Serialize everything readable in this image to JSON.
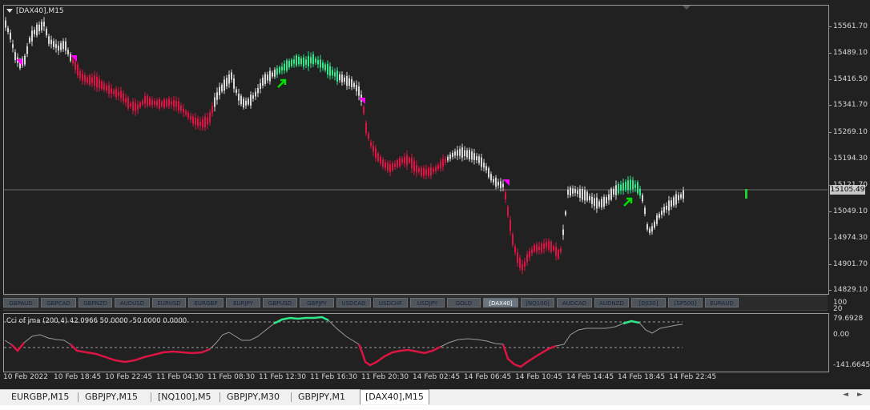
{
  "chart": {
    "title": "[DAX40],M15",
    "current_price": "15105.49",
    "price_labels": [
      "15561.70",
      "15489.10",
      "15416.50",
      "15341.70",
      "15269.10",
      "15194.30",
      "15121.70",
      "15049.10",
      "14974.30",
      "14901.70",
      "14829.10"
    ],
    "indicator_title": "Cci of jma (200,4) 42.0966 50.0000 -50.0000 0.0000",
    "indicator_top_labels": [
      "100",
      "20"
    ],
    "indicator_labels": [
      "79.6928",
      "0.00",
      "-141.6645"
    ],
    "time_labels": [
      "10 Feb 2022",
      "10 Feb 18:45",
      "10 Feb 22:45",
      "11 Feb 04:30",
      "11 Feb 08:30",
      "11 Feb 12:30",
      "11 Feb 16:30",
      "11 Feb 20:30",
      "14 Feb 02:45",
      "14 Feb 06:45",
      "14 Feb 10:45",
      "14 Feb 14:45",
      "14 Feb 18:45",
      "14 Feb 22:45"
    ],
    "colors": {
      "bear": "#dc1443",
      "bull": "#2ee88a",
      "neutral": "#d8d8d8",
      "signal_sell": "#ff00ff",
      "signal_buy": "#00e000"
    }
  },
  "symbols": [
    "GBPAUD",
    "GBPCAD",
    "GBPNZD",
    "AUDUSD",
    "EURUSD",
    "EURGBP",
    "EURJPY",
    "GBPUSD",
    "GBPJPY",
    "USDCAD",
    "USDCHF",
    "USDJPY",
    "GOLD",
    "[DAX40]",
    "[NQ100]",
    "AUDCAD",
    "AUDNZD",
    "[DJI30]",
    "[SP500]",
    "EURAUD"
  ],
  "active_symbol": "[DAX40]",
  "tabs": [
    "EURGBP,M15",
    "GBPJPY,M15",
    "[NQ100],M5",
    "GBPJPY,M30",
    "GBPJPY,M1",
    "[DAX40],M15"
  ],
  "active_tab": "[DAX40],M15",
  "scroll": {
    "left": "◄",
    "right": "►"
  }
}
